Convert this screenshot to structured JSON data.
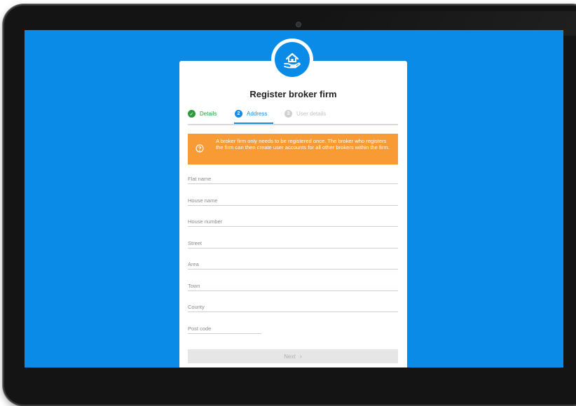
{
  "form": {
    "title": "Register broker firm",
    "steps": [
      {
        "number": "✓",
        "label": "Details",
        "state": "done"
      },
      {
        "number": "2",
        "label": "Address",
        "state": "active"
      },
      {
        "number": "3",
        "label": "User details",
        "state": "pending"
      }
    ],
    "notice": {
      "text": "A broker firm only needs to be registered once. The broker who registers the firm can then create user accounts for all other brokers within the firm.",
      "icon": "question-circle-icon"
    },
    "fields": {
      "flat_name": {
        "placeholder": "Flat name",
        "value": ""
      },
      "house_name": {
        "placeholder": "House name",
        "value": ""
      },
      "house_number": {
        "placeholder": "House number",
        "value": ""
      },
      "street": {
        "placeholder": "Street",
        "value": ""
      },
      "area": {
        "placeholder": "Area",
        "value": ""
      },
      "town": {
        "placeholder": "Town",
        "value": ""
      },
      "county": {
        "placeholder": "County",
        "value": ""
      },
      "post_code": {
        "placeholder": "Post code",
        "value": ""
      }
    },
    "next_label": "Next",
    "next_icon": "chevron-right-icon"
  },
  "logo": {
    "icon": "house-in-hand-icon"
  },
  "colors": {
    "screen_background": "#0a8be8",
    "step_done": "#2e9a3c",
    "step_active": "#1a8be0",
    "notice_background": "#f99b35",
    "button_disabled": "#e6e6e6"
  }
}
